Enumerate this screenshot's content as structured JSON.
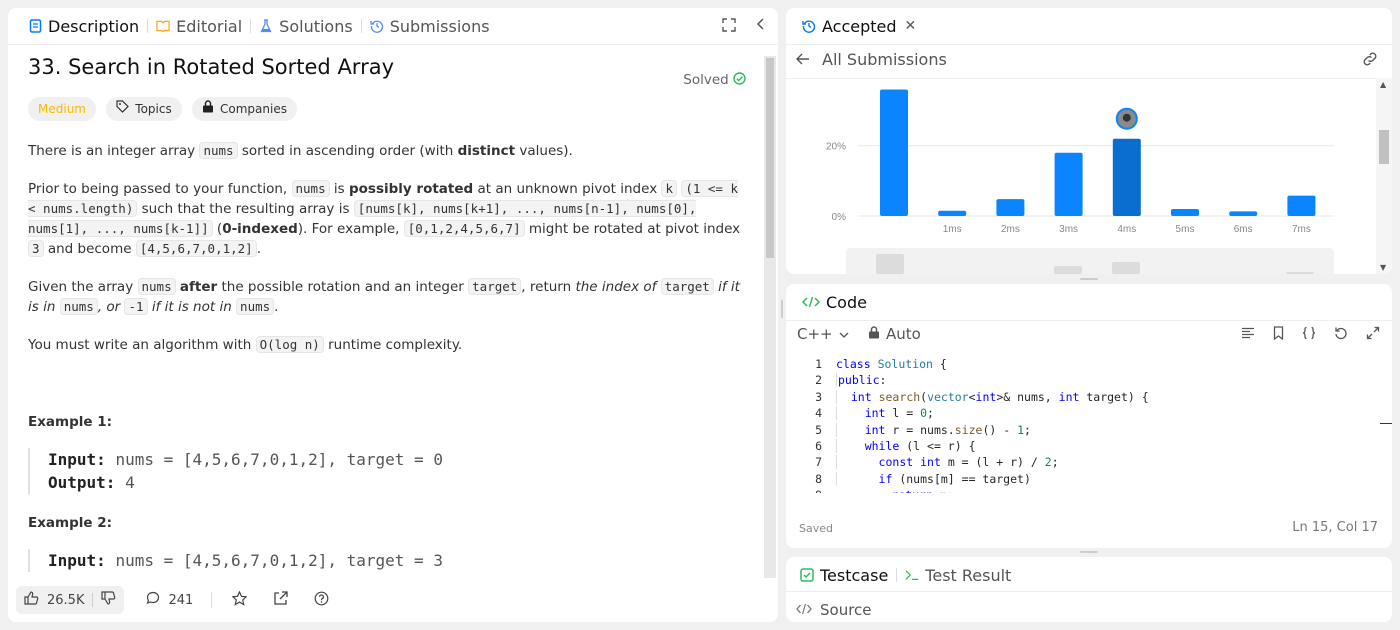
{
  "left": {
    "tabs": [
      {
        "label": "Description"
      },
      {
        "label": "Editorial"
      },
      {
        "label": "Solutions"
      },
      {
        "label": "Submissions"
      }
    ],
    "title": "33. Search in Rotated Sorted Array",
    "status": "Solved",
    "tags": {
      "difficulty": "Medium",
      "topics": "Topics",
      "companies": "Companies"
    },
    "p1": {
      "a": "There is an integer array ",
      "c1": "nums",
      "b": " sorted in ascending order (with ",
      "bold": "distinct",
      "c": " values)."
    },
    "p2": {
      "a": "Prior to being passed to your function, ",
      "c1": "nums",
      "b": " is ",
      "bold1": "possibly rotated",
      "c": " at an unknown pivot index ",
      "c2": "k",
      "c3": "(1 <= k < nums.length)",
      "d": " such that the resulting array is ",
      "c4": "[nums[k], nums[k+1], ..., nums[n-1], nums[0], nums[1], ..., nums[k-1]]",
      "e": " (",
      "bold2": "0-indexed",
      "f": "). For example, ",
      "c5": "[0,1,2,4,5,6,7]",
      "g": " might be rotated at pivot index ",
      "c6": "3",
      "h": " and become ",
      "c7": "[4,5,6,7,0,1,2]",
      "i": "."
    },
    "p3": {
      "a": "Given the array ",
      "c1": "nums",
      "bold": "after",
      "b": " the possible rotation and an integer ",
      "c2": "target",
      "c": ", return ",
      "i1": "the index of ",
      "c3": "target",
      "i2": " if it is in ",
      "c4": "nums",
      "i3": ", or ",
      "c5": "-1",
      "i4": " if it is not in ",
      "c6": "nums",
      "d": "."
    },
    "p4": {
      "a": "You must write an algorithm with ",
      "c1": "O(log n)",
      "b": " runtime complexity."
    },
    "examples": [
      {
        "heading": "Example 1:",
        "input_label": "Input:",
        "input": "nums = [4,5,6,7,0,1,2], target = 0",
        "output_label": "Output:",
        "output": "4"
      },
      {
        "heading": "Example 2:",
        "input_label": "Input:",
        "input": "nums = [4,5,6,7,0,1,2], target = 3"
      }
    ],
    "footer": {
      "likes": "26.5K",
      "comments": "241"
    }
  },
  "submission": {
    "tab": "Accepted",
    "back": "All Submissions",
    "chart_data": {
      "type": "bar",
      "categories": [
        "",
        "1ms",
        "2ms",
        "3ms",
        "4ms",
        "5ms",
        "6ms",
        "7ms"
      ],
      "values": [
        36,
        1.5,
        4.8,
        18,
        22,
        2,
        1.3,
        5.8
      ],
      "highlight_index": 4,
      "ytick_labels": [
        "20%",
        "0%"
      ],
      "yticks": [
        20,
        0
      ],
      "ylim": [
        0,
        37
      ],
      "grid": true
    }
  },
  "code": {
    "title": "Code",
    "language": "C++",
    "mode": "Auto",
    "saved": "Saved",
    "cursor": "Ln 15, Col 17",
    "lines": [
      {
        "n": "1",
        "t": "class Solution {"
      },
      {
        "n": "2",
        "t": "public:"
      },
      {
        "n": "3",
        "t": "  int search(vector<int>& nums, int target) {"
      },
      {
        "n": "4",
        "t": "    int l = 0;"
      },
      {
        "n": "5",
        "t": "    int r = nums.size() - 1;"
      },
      {
        "n": "6",
        "t": "    while (l <= r) {"
      },
      {
        "n": "7",
        "t": "      const int m = (l + r) / 2;"
      },
      {
        "n": "8",
        "t": "      if (nums[m] == target)"
      }
    ]
  },
  "testcase": {
    "tab1": "Testcase",
    "tab2": "Test Result",
    "source": "Source"
  }
}
